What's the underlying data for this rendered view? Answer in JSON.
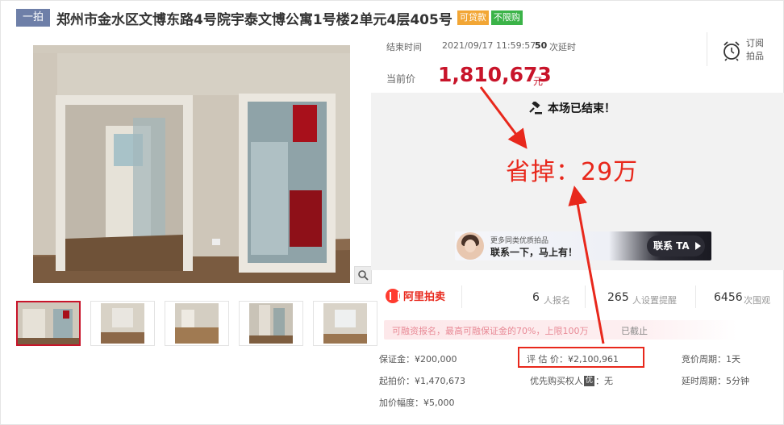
{
  "header": {
    "round_tag": "一拍",
    "title": "郑州市金水区文博东路4号院宇泰文博公寓1号楼2单元4层405号",
    "badge_loan": "可贷款",
    "badge_free": "不限购"
  },
  "auction": {
    "end_label": "结束时间",
    "end_time": "2021/09/17 11:59:57",
    "delay_count": "50",
    "delay_label": "次延时",
    "subscribe_line1": "订阅",
    "subscribe_line2": "拍品",
    "price_label": "当前价",
    "price": "1,810,673",
    "price_unit": "元",
    "ended_text": "本场已结束！",
    "saved_text": "省掉：29万"
  },
  "ad": {
    "line1": "更多同类优质拍品",
    "line2": "联系一下，马上有！",
    "cta": "联系 TA"
  },
  "stats": {
    "brand": "阿里拍卖",
    "signup_num": "6",
    "signup_label": "人报名",
    "remind_num": "265",
    "remind_label": "人设置提醒",
    "view_num": "6456",
    "view_label": "次围观"
  },
  "notice": {
    "text": "可融资报名，最高可融保证金的70%，上限100万",
    "status": "已截止"
  },
  "details": {
    "deposit": "保证金：¥200,000",
    "appraisal": "评 估 价：¥2,100,961",
    "cycle": "竞价周期：1天",
    "start_price": "起拍价：¥1,470,673",
    "priority": "优先购买权人",
    "priority_badge": "优",
    "priority_value": "：无",
    "delay_cycle": "延时周期：5分钟",
    "increment": "加价幅度：¥5,000"
  },
  "colors": {
    "accent_red": "#c8142a",
    "annotation_red": "#e8281c",
    "tag_blue": "#6e7fa8",
    "loan_orange": "#f2a635",
    "free_green": "#3bb348"
  },
  "icons": [
    "gavel-icon",
    "alarm-clock-icon",
    "zoom-icon",
    "aliauction-logo-icon",
    "arrow-right-icon"
  ]
}
